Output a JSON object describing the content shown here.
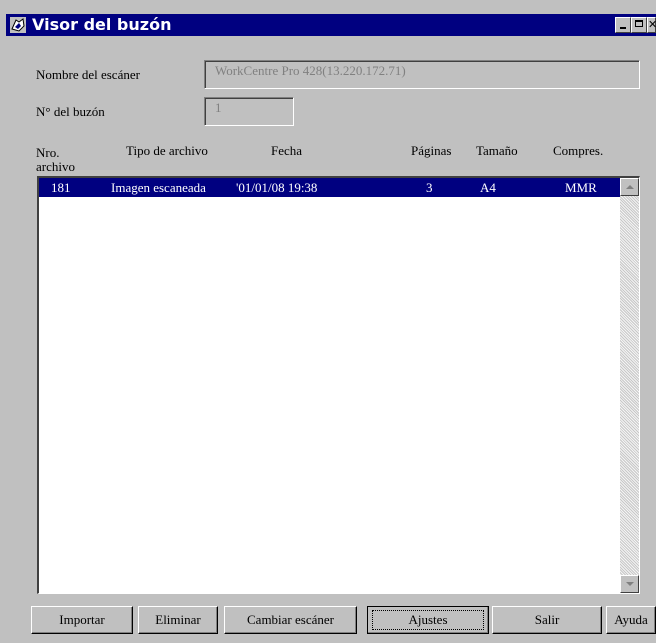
{
  "window": {
    "title": "Visor del buzón",
    "controls": [
      "minimize",
      "maximize",
      "close"
    ]
  },
  "scanner": {
    "label": "Nombre del escáner",
    "value": "WorkCentre Pro 428(13.220.172.71)"
  },
  "mailbox": {
    "label": "N° del buzón",
    "value": "1"
  },
  "table": {
    "headers": {
      "file_no": "Nro.\narchivo",
      "file_type": "Tipo de archivo",
      "date": "Fecha",
      "pages": "Páginas",
      "size": "Tamaño",
      "compression": "Compres."
    },
    "rows": [
      {
        "file_no": "181",
        "file_type": "Imagen escaneada",
        "date": "'01/01/08 19:38",
        "pages": "3",
        "size": "A4",
        "compression": "MMR",
        "selected": true
      }
    ]
  },
  "buttons": {
    "import": "Importar",
    "delete": "Eliminar",
    "change_scanner": "Cambiar escáner",
    "settings": "Ajustes",
    "exit": "Salir",
    "help": "Ayuda"
  },
  "colors": {
    "titlebar": "#000080",
    "selection": "#000080",
    "face": "#c0c0c0"
  }
}
